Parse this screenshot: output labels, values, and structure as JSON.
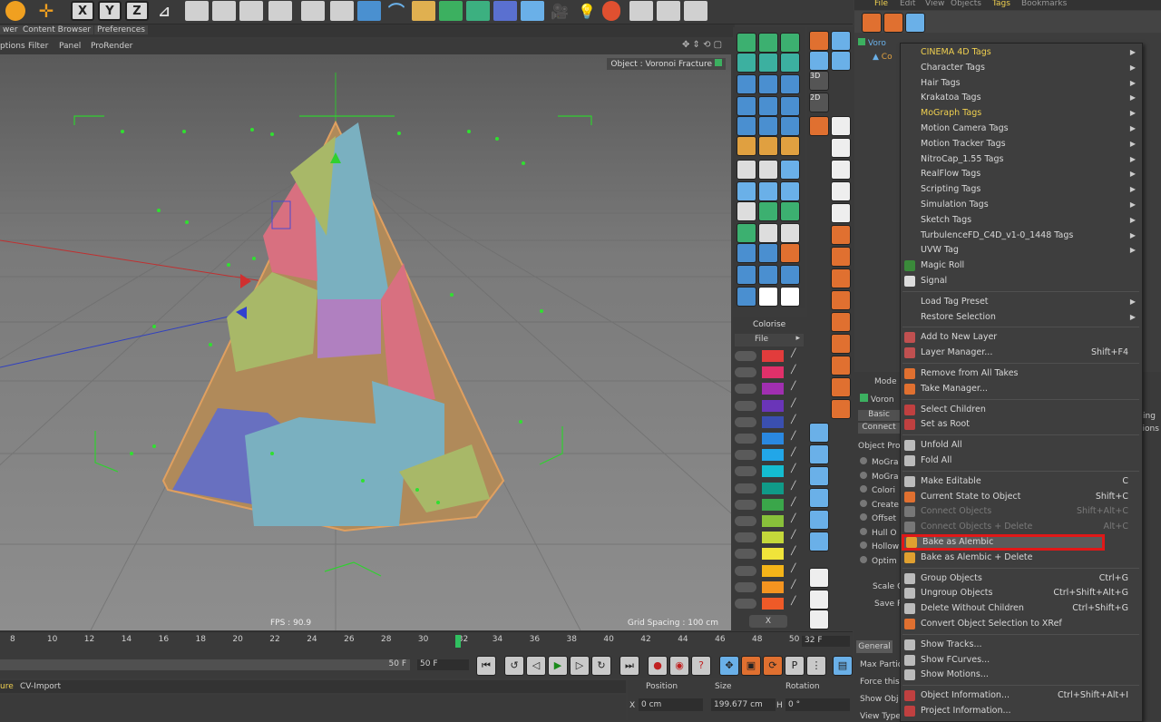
{
  "top_menu": {
    "file": "File",
    "edit": "Edit",
    "view": "View",
    "objects": "Objects",
    "tags": "Tags",
    "bookmarks": "Bookmarks"
  },
  "viewport_tabs": {
    "tab1": "wer",
    "tab2": "Content Browser",
    "tab3": "Preferences"
  },
  "viewport_menu": {
    "m1": "ptions",
    "m2": "Filter",
    "m3": "Panel",
    "m4": "ProRender"
  },
  "viewport": {
    "object_label": "Object : Voronoi Fracture",
    "fps": "FPS : 90.9",
    "grid_spacing": "Grid Spacing : 100 cm"
  },
  "toolbar": {
    "x": "X",
    "y": "Y",
    "z": "Z",
    "three_d": "3D",
    "two_d": "2D"
  },
  "colorise": {
    "title": "Colorise",
    "file": "File",
    "x_button": "X",
    "swatches": [
      "#e23c3c",
      "#e0306a",
      "#a02fb0",
      "#6a35b8",
      "#3a4fb0",
      "#2a88e0",
      "#22a6e8",
      "#14bcd0",
      "#109a88",
      "#3aa64a",
      "#88c03a",
      "#c4d83a",
      "#f0e43a",
      "#f4b418",
      "#f49420",
      "#ee5a28"
    ]
  },
  "object_manager": {
    "item1": "Voro",
    "item2": "Co"
  },
  "attr_panel": {
    "mode": "Mode",
    "voronoi": "Voron",
    "basic": "Basic",
    "connect": "Connect",
    "object_props": "Object Pro",
    "rows": [
      "MoGra",
      "MoGra",
      "Colori",
      "Create",
      "Offset",
      "Hull O",
      "Hollow",
      "Optim"
    ],
    "scale": "Scale C",
    "save": "Save R",
    "general": "General",
    "max_part": "Max Partic",
    "force": "Force this",
    "show_obj": "Show Obj",
    "view_type": "View Type",
    "ing": "ing",
    "tions": "tions"
  },
  "context_menu": {
    "items": [
      {
        "label": "CINEMA 4D Tags",
        "arrow": true,
        "yellow": true
      },
      {
        "label": "Character Tags",
        "arrow": true
      },
      {
        "label": "Hair Tags",
        "arrow": true
      },
      {
        "label": "Krakatoa Tags",
        "arrow": true
      },
      {
        "label": "MoGraph Tags",
        "arrow": true,
        "yellow": true
      },
      {
        "label": "Motion Camera Tags",
        "arrow": true
      },
      {
        "label": "Motion Tracker Tags",
        "arrow": true
      },
      {
        "label": "NitroCap_1.55 Tags",
        "arrow": true
      },
      {
        "label": "RealFlow Tags",
        "arrow": true
      },
      {
        "label": "Scripting Tags",
        "arrow": true
      },
      {
        "label": "Simulation Tags",
        "arrow": true
      },
      {
        "label": "Sketch Tags",
        "arrow": true
      },
      {
        "label": "TurbulenceFD_C4D_v1-0_1448 Tags",
        "arrow": true
      },
      {
        "label": "UVW Tag",
        "arrow": true
      },
      {
        "label": "Magic Roll",
        "icon": "magic-roll-icon",
        "icolor": "#3a8a3a"
      },
      {
        "label": "Signal",
        "icon": "signal-icon",
        "icolor": "#dcdcdc"
      },
      {
        "sep": true
      },
      {
        "label": "Load Tag Preset",
        "arrow": true
      },
      {
        "label": "Restore Selection",
        "arrow": true
      },
      {
        "sep": true
      },
      {
        "label": "Add to New Layer",
        "icon": "layer-icon",
        "icolor": "#c05050"
      },
      {
        "label": "Layer Manager...",
        "shortcut": "Shift+F4",
        "icon": "layer-manager-icon",
        "icolor": "#c05050"
      },
      {
        "sep": true
      },
      {
        "label": "Remove from All Takes",
        "icon": "take-icon",
        "icolor": "#e07030"
      },
      {
        "label": "Take Manager...",
        "icon": "take-manager-icon",
        "icolor": "#e07030"
      },
      {
        "sep": true
      },
      {
        "label": "Select Children",
        "icon": "select-children-icon",
        "icolor": "#c04040"
      },
      {
        "label": "Set as Root",
        "icon": "root-icon",
        "icolor": "#c04040"
      },
      {
        "sep": true
      },
      {
        "label": "Unfold All",
        "icon": "unfold-icon",
        "icolor": "#bbbbbb"
      },
      {
        "label": "Fold All",
        "icon": "fold-icon",
        "icolor": "#bbbbbb"
      },
      {
        "sep": true
      },
      {
        "label": "Make Editable",
        "shortcut": "C",
        "icon": "editable-icon",
        "icolor": "#bbbbbb"
      },
      {
        "label": "Current State to Object",
        "shortcut": "Shift+C",
        "icon": "state-icon",
        "icolor": "#e07030"
      },
      {
        "label": "Connect Objects",
        "shortcut": "Shift+Alt+C",
        "disabled": true,
        "icon": "connect-icon",
        "icolor": "#777777"
      },
      {
        "label": "Connect Objects + Delete",
        "shortcut": "Alt+C",
        "disabled": true,
        "icon": "connect-delete-icon",
        "icolor": "#777777"
      },
      {
        "label": "Bake as Alembic",
        "highlight": true,
        "icon": "alembic-icon",
        "icolor": "#e0a030"
      },
      {
        "label": "Bake as Alembic + Delete",
        "icon": "alembic-delete-icon",
        "icolor": "#e0a030"
      },
      {
        "sep": true
      },
      {
        "label": "Group Objects",
        "shortcut": "Ctrl+G",
        "icon": "group-icon",
        "icolor": "#bbbbbb"
      },
      {
        "label": "Ungroup Objects",
        "shortcut": "Ctrl+Shift+Alt+G",
        "icon": "ungroup-icon",
        "icolor": "#bbbbbb"
      },
      {
        "label": "Delete Without Children",
        "shortcut": "Ctrl+Shift+G",
        "icon": "delete-icon",
        "icolor": "#bbbbbb"
      },
      {
        "label": "Convert Object Selection to XRef",
        "icon": "xref-icon",
        "icolor": "#e07030"
      },
      {
        "sep": true
      },
      {
        "label": "Show Tracks...",
        "icon": "tracks-icon",
        "icolor": "#bbbbbb"
      },
      {
        "label": "Show FCurves...",
        "icon": "fcurves-icon",
        "icolor": "#bbbbbb"
      },
      {
        "label": "Show Motions...",
        "icon": "motions-icon",
        "icolor": "#bbbbbb"
      },
      {
        "sep": true
      },
      {
        "label": "Object Information...",
        "shortcut": "Ctrl+Shift+Alt+I",
        "icon": "info-icon",
        "icolor": "#c04040"
      },
      {
        "label": "Project Information...",
        "icon": "project-info-icon",
        "icolor": "#c04040"
      }
    ]
  },
  "timeline": {
    "ticks": [
      "8",
      "10",
      "12",
      "14",
      "16",
      "18",
      "20",
      "22",
      "24",
      "26",
      "28",
      "30",
      "32",
      "34",
      "36",
      "38",
      "40",
      "42",
      "44",
      "46",
      "48",
      "50"
    ],
    "current_frame": "32",
    "frame_field": "32 F",
    "end_field": "50 F",
    "end_field2": "50 F"
  },
  "bottom_tabs": {
    "t1": "ure",
    "t2": "CV-Import"
  },
  "coords": {
    "position": "Position",
    "size": "Size",
    "rotation": "Rotation",
    "x_label": "X",
    "x_val": "0 cm",
    "size_val": "199.677 cm",
    "h_label": "H",
    "h_val": "0 °"
  }
}
